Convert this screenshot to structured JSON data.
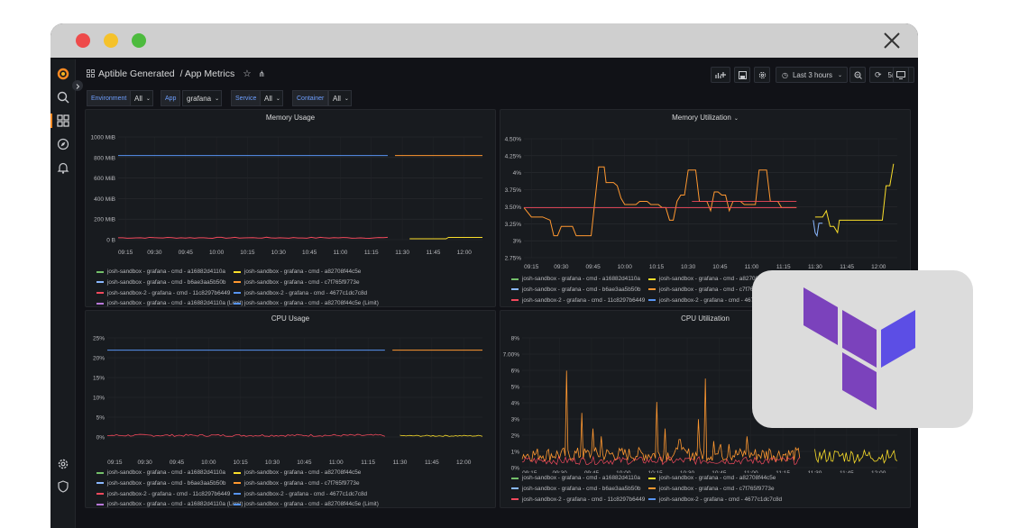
{
  "dashboard": {
    "folder": "Aptible Generated",
    "title": "/ App Metrics",
    "time_range": "Last 3 hours",
    "refresh": "5m"
  },
  "variables": [
    {
      "label": "Environment",
      "value": "All"
    },
    {
      "label": "App",
      "value": "grafana"
    },
    {
      "label": "Service",
      "value": "All"
    },
    {
      "label": "Container",
      "value": "All"
    }
  ],
  "colors": {
    "green": "#73bf69",
    "yellow": "#fade2a",
    "blue": "#8ab8ff",
    "orange": "#ff9830",
    "red": "#f2495c",
    "purple": "#b877d9",
    "slate": "#5794f2"
  },
  "legend_memory": [
    {
      "name": "josh-sandbox - grafana - cmd - a16882d4110a",
      "color": "green"
    },
    {
      "name": "josh-sandbox - grafana - cmd - a82708f44c5e",
      "color": "yellow"
    },
    {
      "name": "josh-sandbox - grafana - cmd - b6ae3aa5b50b",
      "color": "blue"
    },
    {
      "name": "josh-sandbox - grafana - cmd - c7f765f9773e",
      "color": "orange"
    },
    {
      "name": "josh-sandbox-2 - grafana - cmd - 11c8297b6449",
      "color": "red"
    },
    {
      "name": "josh-sandbox-2 - grafana - cmd - 4677c1dc7c8d",
      "color": "slate"
    },
    {
      "name": "josh-sandbox - grafana - cmd - a16882d4110a (Limit)",
      "color": "purple"
    },
    {
      "name": "josh-sandbox - grafana - cmd - a82708f44c5e (Limit)",
      "color": "slate"
    },
    {
      "name": "josh-sandbox - grafana - cmd - b6ae3aa5b50b (Limit)",
      "color": "green"
    },
    {
      "name": "josh-sandbox - grafana - cmd - c7f765f9773e (Limit)",
      "color": "yellow"
    },
    {
      "name": "josh-sandbox-2 - grafana - cmd - 11c8297b6449 (Limit)",
      "color": "blue"
    },
    {
      "name": "josh-sandbox-2 - grafana - cmd - 4677c1dc7c8d (Limit)",
      "color": "orange"
    }
  ],
  "legend_util": [
    {
      "name": "josh-sandbox - grafana - cmd - a16882d4110a",
      "color": "green"
    },
    {
      "name": "josh-sandbox - grafana - cmd - a82708f44c5e",
      "color": "yellow"
    },
    {
      "name": "josh-sandbox - grafana - cmd - b6ae3aa5b50b",
      "color": "blue"
    },
    {
      "name": "josh-sandbox - grafana - cmd - c7f765f9773e",
      "color": "orange"
    },
    {
      "name": "josh-sandbox-2 - grafana - cmd - 11c8297b6449",
      "color": "red"
    },
    {
      "name": "josh-sandbox-2 - grafana - cmd - 4677c1dc7c8d",
      "color": "slate"
    }
  ],
  "x_ticks": [
    "09:15",
    "09:30",
    "09:45",
    "10:00",
    "10:15",
    "10:30",
    "10:45",
    "11:00",
    "11:15",
    "11:30",
    "11:45",
    "12:00"
  ],
  "chart_data": [
    {
      "type": "line",
      "title": "Memory Usage",
      "yticks": [
        "0 B",
        "200 MiB",
        "400 MiB",
        "600 MiB",
        "800 MiB",
        "1000 MiB"
      ],
      "ylim": [
        0,
        1100
      ]
    },
    {
      "type": "line",
      "title": "Memory Utilization",
      "yticks": [
        "2.75%",
        "3%",
        "3.25%",
        "3.50%",
        "3.75%",
        "4%",
        "4.25%",
        "4.50%"
      ],
      "ylim": [
        2.7,
        4.6
      ]
    },
    {
      "type": "line",
      "title": "CPU Usage",
      "yticks": [
        "0%",
        "5%",
        "10%",
        "15%",
        "20%",
        "25%"
      ],
      "ylim": [
        0,
        27
      ]
    },
    {
      "type": "line",
      "title": "CPU Utilization",
      "yticks": [
        "0%",
        "1%",
        "2%",
        "3%",
        "4%",
        "5%",
        "6%",
        "7.00%",
        "8%"
      ],
      "ylim": [
        0,
        8.3
      ]
    }
  ]
}
